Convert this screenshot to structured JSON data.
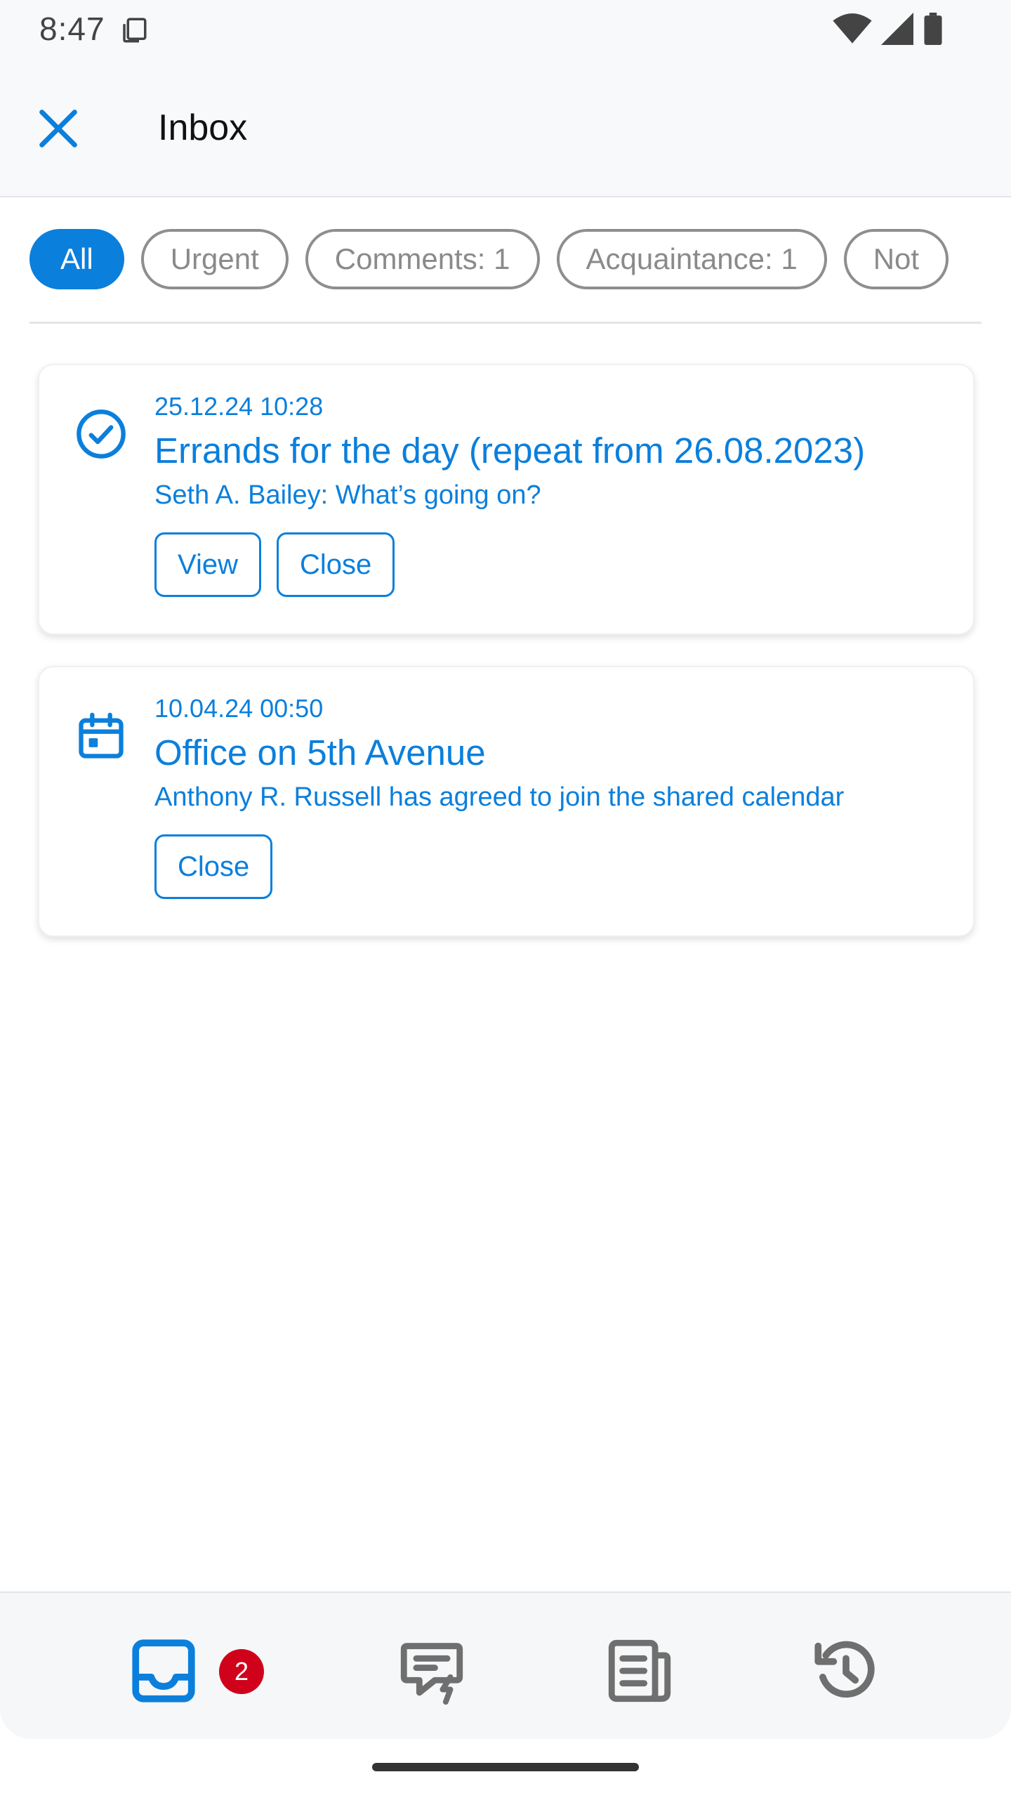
{
  "status_bar": {
    "time": "8:47",
    "icons": [
      "copy-icon",
      "wifi-icon",
      "signal-icon",
      "battery-icon"
    ]
  },
  "header": {
    "title": "Inbox",
    "close_icon": "close-icon"
  },
  "filters": {
    "chips": [
      {
        "label": "All",
        "active": true
      },
      {
        "label": "Urgent",
        "active": false
      },
      {
        "label": "Comments: 1",
        "active": false
      },
      {
        "label": "Acquaintance: 1",
        "active": false
      },
      {
        "label": "Not",
        "active": false
      }
    ]
  },
  "notifications": [
    {
      "icon": "check-circle-icon",
      "date": "25.12.24 10:28",
      "title": "Errands for the day (repeat from 26.08.2023)",
      "subtitle": "Seth A. Bailey: What’s going on?",
      "actions": [
        "View",
        "Close"
      ]
    },
    {
      "icon": "calendar-icon",
      "date": "10.04.24 00:50",
      "title": "Office on 5th Avenue",
      "subtitle": "Anthony R. Russell has agreed to join the shared calendar",
      "actions": [
        "Close"
      ]
    }
  ],
  "bottom_nav": {
    "items": [
      {
        "icon": "inbox-icon",
        "active": true
      },
      {
        "icon": "message-lightning-icon",
        "active": false
      },
      {
        "icon": "news-icon",
        "active": false
      },
      {
        "icon": "history-icon",
        "active": false
      }
    ],
    "inbox_badge": "2"
  },
  "colors": {
    "accent": "#0b7fdc",
    "badge": "#d0021b",
    "chip_border": "#8e8e8e"
  }
}
